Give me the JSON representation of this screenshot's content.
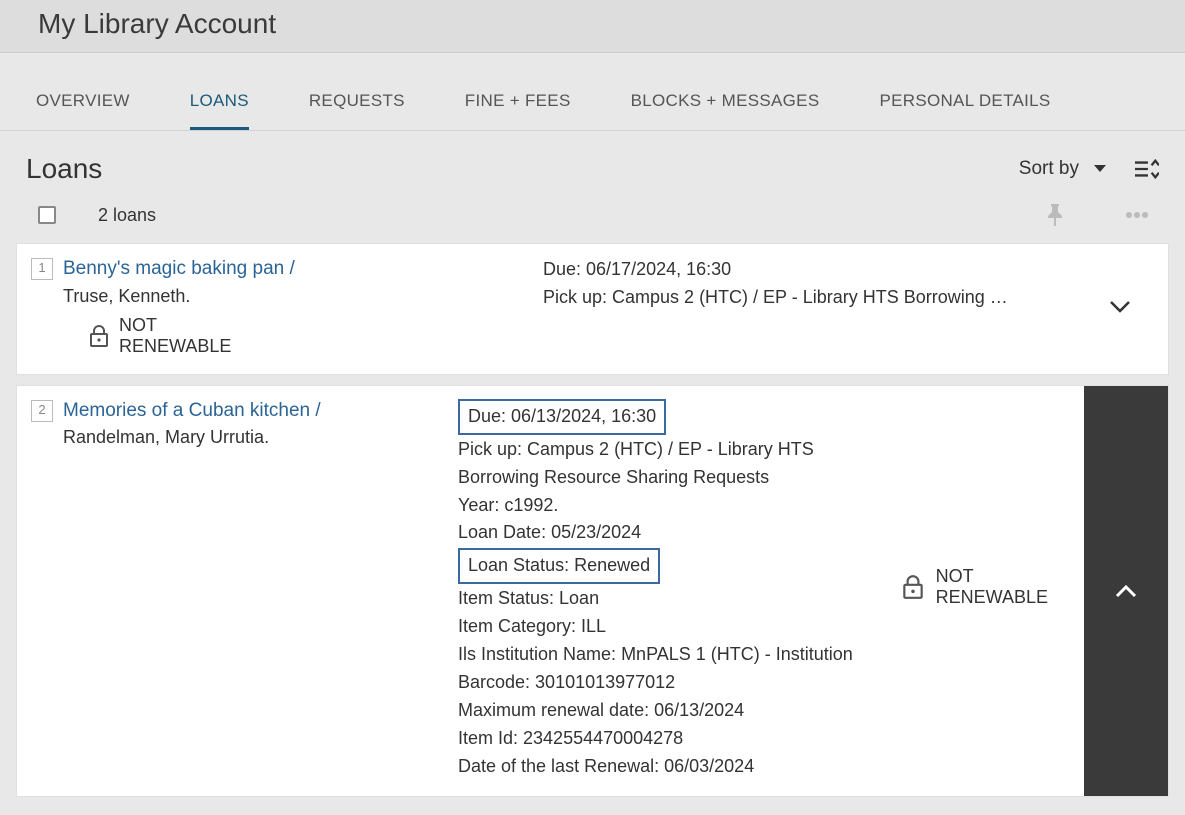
{
  "header": {
    "title": "My Library Account"
  },
  "tabs": [
    "OVERVIEW",
    "LOANS",
    "REQUESTS",
    "FINE + FEES",
    "BLOCKS + MESSAGES",
    "PERSONAL DETAILS"
  ],
  "active_tab": "LOANS",
  "section": {
    "title": "Loans",
    "sort_label": "Sort by"
  },
  "count_label": "2 loans",
  "not_renewable_lines": {
    "l1": "NOT",
    "l2": "RENEWABLE"
  },
  "loans": [
    {
      "num": "1",
      "title": "Benny's magic baking pan /",
      "author": "Truse, Kenneth.",
      "due": "Due: 06/17/2024, 16:30",
      "pickup": "Pick up: Campus 2 (HTC) / EP - Library HTS Borrowing Resour…",
      "expanded": false
    },
    {
      "num": "2",
      "title": "Memories of a Cuban kitchen /",
      "author": "Randelman, Mary Urrutia.",
      "due": "Due: 06/13/2024, 16:30",
      "pickup": "Pick up: Campus 2 (HTC) / EP - Library HTS Borrowing Resource Sharing Requests",
      "details": {
        "year": "Year: c1992.",
        "loan_date": "Loan Date: 05/23/2024",
        "loan_status": "Loan Status: Renewed",
        "item_status": "Item Status: Loan",
        "item_category": "Item Category: ILL",
        "ils": "Ils Institution Name: MnPALS 1 (HTC) - Institution",
        "barcode": "Barcode: 30101013977012",
        "max_renew": "Maximum renewal date: 06/13/2024",
        "item_id": "Item Id: 2342554470004278",
        "last_renew": "Date of the last Renewal: 06/03/2024"
      },
      "expanded": true
    }
  ]
}
